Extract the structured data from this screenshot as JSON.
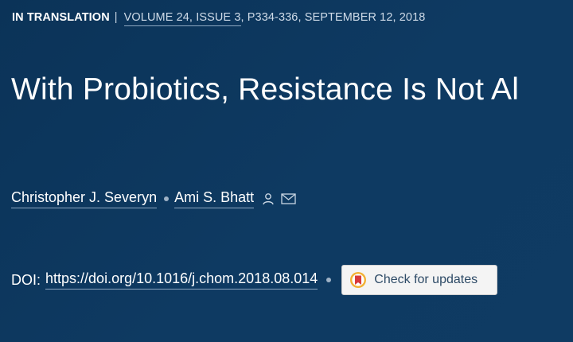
{
  "header": {
    "section": "IN TRANSLATION",
    "divider": "|",
    "issue": "VOLUME 24, ISSUE 3",
    "pages_date": ", P334-336, SEPTEMBER 12, 2018"
  },
  "article": {
    "title": "With Probiotics, Resistance Is Not Al"
  },
  "authors": [
    {
      "name": "Christopher J. Severyn"
    },
    {
      "name": "Ami S. Bhatt"
    }
  ],
  "doi": {
    "label": "DOI:",
    "url": "https://doi.org/10.1016/j.chom.2018.08.014"
  },
  "check_updates": {
    "label": "Check for updates"
  },
  "icons": {
    "person": "person-icon",
    "mail": "mail-icon",
    "updates": "crossmark-icon"
  },
  "colors": {
    "background": "#0e3a62",
    "crossmark_red": "#d83a3a",
    "crossmark_gold": "#f2b134"
  }
}
